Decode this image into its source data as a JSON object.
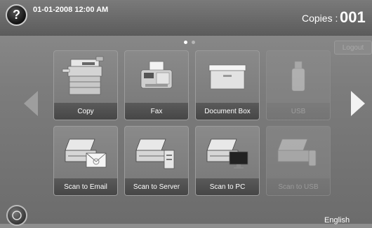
{
  "header": {
    "help_symbol": "?",
    "datetime": "01-01-2008 12:00 AM",
    "copies_label": "Copies :",
    "copies_count": "001"
  },
  "logout_label": "Logout",
  "tiles": [
    {
      "label": "Copy",
      "icon": "copier-icon",
      "enabled": true
    },
    {
      "label": "Fax",
      "icon": "fax-icon",
      "enabled": true
    },
    {
      "label": "Document Box",
      "icon": "document-box-icon",
      "enabled": true
    },
    {
      "label": "USB",
      "icon": "usb-icon",
      "enabled": false
    },
    {
      "label": "Scan to Email",
      "icon": "scan-to-email-icon",
      "enabled": true
    },
    {
      "label": "Scan to Server",
      "icon": "scan-to-server-icon",
      "enabled": true
    },
    {
      "label": "Scan to PC",
      "icon": "scan-to-pc-icon",
      "enabled": true
    },
    {
      "label": "Scan to USB",
      "icon": "scan-to-usb-icon",
      "enabled": false
    }
  ],
  "pagination": {
    "pages": 2,
    "current": 1
  },
  "language": "English",
  "colors": {
    "background": "#7c7c7c",
    "tile": "#808080",
    "label_bar": "#4e4e4e",
    "text": "#ffffff"
  }
}
